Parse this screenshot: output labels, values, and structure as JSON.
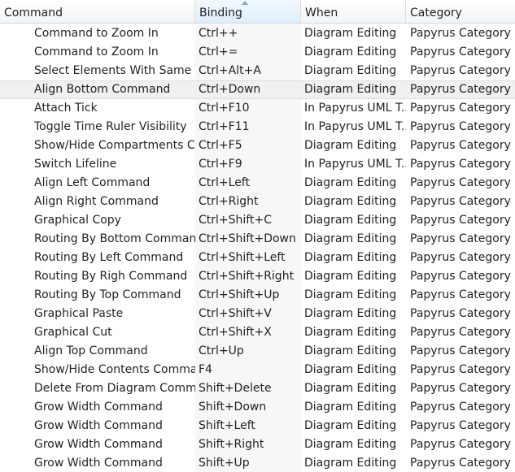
{
  "columns": [
    {
      "label": "Command"
    },
    {
      "label": "Binding"
    },
    {
      "label": "When"
    },
    {
      "label": "Category"
    }
  ],
  "sorted_column": "Binding",
  "sort_direction": "ascending",
  "selected_row": 3,
  "rows": [
    {
      "command": "Command to Zoom In",
      "binding": "Ctrl++",
      "when": "Diagram Editing",
      "category": "Papyrus Category"
    },
    {
      "command": "Command to Zoom In",
      "binding": "Ctrl+=",
      "when": "Diagram Editing",
      "category": "Papyrus Category"
    },
    {
      "command": "Select Elements With Same Ty",
      "binding": "Ctrl+Alt+A",
      "when": "Diagram Editing",
      "category": "Papyrus Category"
    },
    {
      "command": "Align Bottom Command",
      "binding": "Ctrl+Down",
      "when": "Diagram Editing",
      "category": "Papyrus Category"
    },
    {
      "command": "Attach Tick",
      "binding": "Ctrl+F10",
      "when": "In Papyrus UML T...",
      "category": "Papyrus Category"
    },
    {
      "command": "Toggle Time Ruler Visibility",
      "binding": "Ctrl+F11",
      "when": "In Papyrus UML T...",
      "category": "Papyrus Category"
    },
    {
      "command": "Show/Hide Compartments Co",
      "binding": "Ctrl+F5",
      "when": "Diagram Editing",
      "category": "Papyrus Category"
    },
    {
      "command": "Switch Lifeline",
      "binding": "Ctrl+F9",
      "when": "In Papyrus UML T...",
      "category": "Papyrus Category"
    },
    {
      "command": "Align Left Command",
      "binding": "Ctrl+Left",
      "when": "Diagram Editing",
      "category": "Papyrus Category"
    },
    {
      "command": "Align Right Command",
      "binding": "Ctrl+Right",
      "when": "Diagram Editing",
      "category": "Papyrus Category"
    },
    {
      "command": "Graphical Copy",
      "binding": "Ctrl+Shift+C",
      "when": "Diagram Editing",
      "category": "Papyrus Category"
    },
    {
      "command": "Routing By Bottom Command",
      "binding": "Ctrl+Shift+Down",
      "when": "Diagram Editing",
      "category": "Papyrus Category"
    },
    {
      "command": "Routing By Left Command",
      "binding": "Ctrl+Shift+Left",
      "when": "Diagram Editing",
      "category": "Papyrus Category"
    },
    {
      "command": "Routing By Righ Command",
      "binding": "Ctrl+Shift+Right",
      "when": "Diagram Editing",
      "category": "Papyrus Category"
    },
    {
      "command": "Routing By Top Command",
      "binding": "Ctrl+Shift+Up",
      "when": "Diagram Editing",
      "category": "Papyrus Category"
    },
    {
      "command": "Graphical Paste",
      "binding": "Ctrl+Shift+V",
      "when": "Diagram Editing",
      "category": "Papyrus Category"
    },
    {
      "command": "Graphical Cut",
      "binding": "Ctrl+Shift+X",
      "when": "Diagram Editing",
      "category": "Papyrus Category"
    },
    {
      "command": "Align Top Command",
      "binding": "Ctrl+Up",
      "when": "Diagram Editing",
      "category": "Papyrus Category"
    },
    {
      "command": "Show/Hide Contents Commar",
      "binding": "F4",
      "when": "Diagram Editing",
      "category": "Papyrus Category"
    },
    {
      "command": "Delete From Diagram Comma",
      "binding": "Shift+Delete",
      "when": "Diagram Editing",
      "category": "Papyrus Category"
    },
    {
      "command": "Grow Width Command",
      "binding": "Shift+Down",
      "when": "Diagram Editing",
      "category": "Papyrus Category"
    },
    {
      "command": "Grow Width Command",
      "binding": "Shift+Left",
      "when": "Diagram Editing",
      "category": "Papyrus Category"
    },
    {
      "command": "Grow Width Command",
      "binding": "Shift+Right",
      "when": "Diagram Editing",
      "category": "Papyrus Category"
    },
    {
      "command": "Grow Width Command",
      "binding": "Shift+Up",
      "when": "Diagram Editing",
      "category": "Papyrus Category"
    }
  ]
}
